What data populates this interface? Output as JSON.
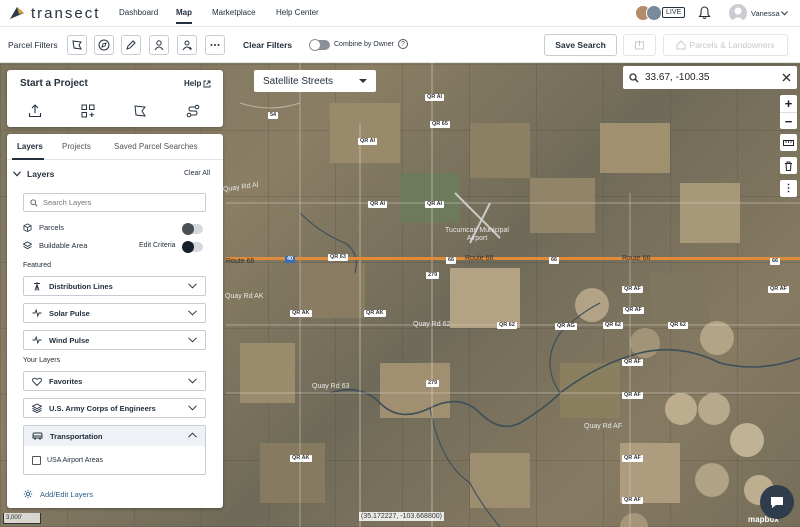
{
  "nav": {
    "logo_text": "transect",
    "links": [
      "Dashboard",
      "Map",
      "Marketplace",
      "Help Center"
    ],
    "live_label": "LIVE",
    "user_name": "Vanessa"
  },
  "filterbar": {
    "label": "Parcel Filters",
    "clear_filters": "Clear Filters",
    "combine_by_owner": "Combine by Owner",
    "help_icon": "?",
    "save_search": "Save Search",
    "parcels_landowners": "Parcels & Landowners"
  },
  "map": {
    "basemap": "Satellite Streets",
    "coordinate_search": "33.67, -100.35",
    "zoom_in": "+",
    "zoom_out": "−",
    "more": "⋮",
    "coord_readout": "(35.172227, -103.668800)",
    "scale": "3,000'",
    "attribution": "mapbox",
    "road_labels": [
      "QR AI",
      "QR AI",
      "QR 65",
      "QR AI",
      "QR AI",
      "QR 63",
      "66",
      "66",
      "66",
      "Route 66",
      "Route 66",
      "279",
      "QR AF",
      "QR AF",
      "QR AF",
      "QR AK",
      "QR AK",
      "QR 62",
      "QR 62",
      "QR AG",
      "QR 62",
      "QR AF",
      "279",
      "QR AF",
      "QR AF",
      "QR AK",
      "54",
      "40",
      "QR AF"
    ],
    "place_labels": [
      "Tucumcari Municipal Airport",
      "Quay Rd AI",
      "Quay Rd AK",
      "Quay Rd 62",
      "Quay Rd AF",
      "Route 66",
      "Quay Rd 63"
    ]
  },
  "project": {
    "title": "Start a Project",
    "help": "Help"
  },
  "layers": {
    "tabs": [
      "Layers",
      "Projects",
      "Saved Parcel Searches"
    ],
    "heading": "Layers",
    "clear_all": "Clear All",
    "search_placeholder": "Search Layers",
    "parcels": "Parcels",
    "buildable_area": "Buildable Area",
    "edit_criteria": "Edit Criteria",
    "featured_label": "Featured",
    "featured": [
      "Distribution Lines",
      "Solar Pulse",
      "Wind Pulse"
    ],
    "your_layers_label": "Your Layers",
    "your_layers": [
      "Favorites",
      "U.S. Army Corps of Engineers"
    ],
    "transportation": "Transportation",
    "usa_airport_areas": "USA Airport Areas",
    "add_edit": "Add/Edit Layers"
  }
}
